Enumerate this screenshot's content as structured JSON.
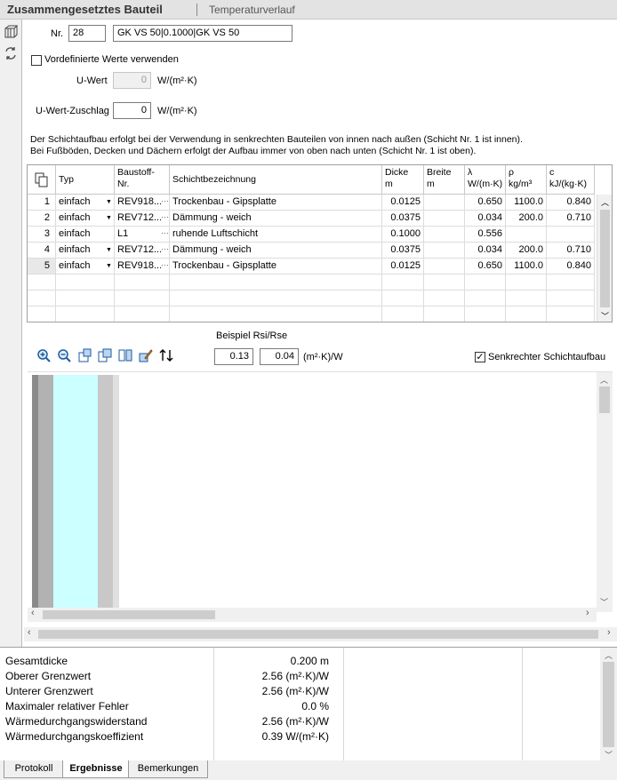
{
  "title": {
    "main": "Zusammengesetztes Bauteil",
    "sub": "Temperaturverlauf"
  },
  "left_icons": [
    "component-icon",
    "swap-icon"
  ],
  "form": {
    "nr_label": "Nr.",
    "nr_value": "28",
    "name_value": "GK VS 50|0.1000|GK VS 50",
    "predefined_label": "Vordefinierte Werte verwenden",
    "predefined_checked": false,
    "uwert_label": "U-Wert",
    "uwert_value": "0",
    "uwert_unit": "W/(m²·K)",
    "zuschlag_label": "U-Wert-Zuschlag",
    "zuschlag_value": "0",
    "zuschlag_unit": "W/(m²·K)",
    "info1": "Der Schichtaufbau erfolgt bei der Verwendung in senkrechten Bauteilen von innen nach außen (Schicht Nr. 1 ist innen).",
    "info2": "Bei Fußböden, Decken und Dächern erfolgt der Aufbau immer von oben nach unten (Schicht Nr. 1 ist oben)."
  },
  "table": {
    "headers": {
      "typ": "Typ",
      "baustoff1": "Baustoff-",
      "baustoff2": "Nr.",
      "bez": "Schichtbezeichnung",
      "dicke1": "Dicke",
      "dicke2": "m",
      "breite1": "Breite",
      "breite2": "m",
      "lambda1": "λ",
      "lambda2": "W/(m·K)",
      "rho1": "ρ",
      "rho2": "kg/m³",
      "c1": "c",
      "c2": "kJ/(kg·K)"
    },
    "rows": [
      {
        "nr": "1",
        "typ": "einfach",
        "baustoff": "REV918...",
        "bez": "Trockenbau - Gipsplatte",
        "dicke": "0.0125",
        "breite": "",
        "lambda": "0.650",
        "rho": "1100.0",
        "c": "0.840"
      },
      {
        "nr": "2",
        "typ": "einfach",
        "baustoff": "REV712...",
        "bez": "Dämmung - weich",
        "dicke": "0.0375",
        "breite": "",
        "lambda": "0.034",
        "rho": "200.0",
        "c": "0.710"
      },
      {
        "nr": "3",
        "typ": "einfach",
        "baustoff": "L1",
        "bez": "ruhende Luftschicht",
        "dicke": "0.1000",
        "breite": "",
        "lambda": "0.556",
        "rho": "",
        "c": ""
      },
      {
        "nr": "4",
        "typ": "einfach",
        "baustoff": "REV712...",
        "bez": "Dämmung - weich",
        "dicke": "0.0375",
        "breite": "",
        "lambda": "0.034",
        "rho": "200.0",
        "c": "0.710"
      },
      {
        "nr": "5",
        "typ": "einfach",
        "baustoff": "REV918...",
        "bez": "Trockenbau - Gipsplatte",
        "dicke": "0.0125",
        "breite": "",
        "lambda": "0.650",
        "rho": "1100.0",
        "c": "0.840"
      }
    ]
  },
  "view": {
    "rs_label": "Beispiel Rsi/Rse",
    "rsi": "0.13",
    "rse": "0.04",
    "rs_unit": "(m²·K)/W",
    "senkrecht_label": "Senkrechter Schichtaufbau",
    "senkrecht_checked": true,
    "tools": [
      "zoom-in-icon",
      "zoom-out-icon",
      "fit-width-icon",
      "fit-height-icon",
      "book-icon",
      "edit-icon",
      "sort-icon"
    ]
  },
  "results": [
    {
      "label": "Gesamtdicke",
      "value": "0.200 m"
    },
    {
      "label": "Oberer Grenzwert",
      "value": "2.56 (m²·K)/W"
    },
    {
      "label": "Unterer Grenzwert",
      "value": "2.56 (m²·K)/W"
    },
    {
      "label": "Maximaler relativer Fehler",
      "value": "0.0 %"
    },
    {
      "label": "Wärmedurchgangswiderstand",
      "value": "2.56 (m²·K)/W"
    },
    {
      "label": "Wärmedurchgangskoeffizient",
      "value": "0.39 W/(m²·K)"
    }
  ],
  "tabs": [
    "Protokoll",
    "Ergebnisse",
    "Bemerkungen"
  ],
  "active_tab": "Ergebnisse"
}
